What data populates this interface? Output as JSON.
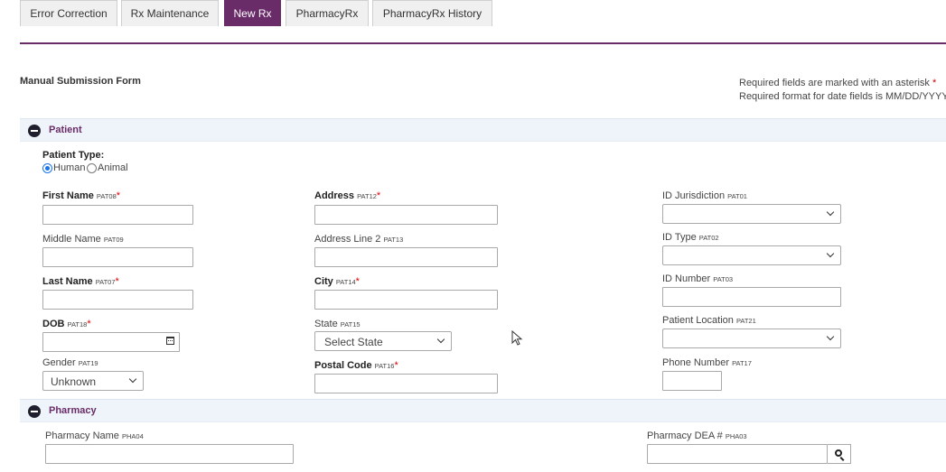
{
  "tabs": [
    {
      "label": "Error Correction",
      "active": false
    },
    {
      "label": "Rx Maintenance",
      "active": false
    },
    {
      "label": "New Rx",
      "active": true
    },
    {
      "label": "PharmacyRx",
      "active": false
    },
    {
      "label": "PharmacyRx History",
      "active": false
    }
  ],
  "form": {
    "title": "Manual Submission Form",
    "required_note": "Required fields are marked with an asterisk",
    "asterisk": "*",
    "date_note": "Required format for date fields is MM/DD/YYYY"
  },
  "patient": {
    "section_title": "Patient",
    "patient_type_label": "Patient Type:",
    "type_options": [
      "Human",
      "Animal"
    ],
    "selected_type": "Human",
    "first_name": {
      "label": "First Name",
      "code": "PAT08",
      "value": ""
    },
    "middle_name": {
      "label": "Middle Name",
      "code": "PAT09",
      "value": ""
    },
    "last_name": {
      "label": "Last Name",
      "code": "PAT07",
      "value": ""
    },
    "dob": {
      "label": "DOB",
      "code": "PAT18",
      "value": ""
    },
    "gender": {
      "label": "Gender",
      "code": "PAT19",
      "value": "Unknown"
    },
    "address": {
      "label": "Address",
      "code": "PAT12",
      "value": ""
    },
    "address2": {
      "label": "Address Line 2",
      "code": "PAT13",
      "value": ""
    },
    "city": {
      "label": "City",
      "code": "PAT14",
      "value": ""
    },
    "state": {
      "label": "State",
      "code": "PAT15",
      "value": "Select State"
    },
    "postal_code": {
      "label": "Postal Code",
      "code": "PAT16",
      "value": ""
    },
    "id_jurisdiction": {
      "label": "ID Jurisdiction",
      "code": "PAT01",
      "value": ""
    },
    "id_type": {
      "label": "ID Type",
      "code": "PAT02",
      "value": ""
    },
    "id_number": {
      "label": "ID Number",
      "code": "PAT03",
      "value": ""
    },
    "patient_location": {
      "label": "Patient Location",
      "code": "PAT21",
      "value": ""
    },
    "phone_number": {
      "label": "Phone Number",
      "code": "PAT17",
      "value": ""
    }
  },
  "pharmacy": {
    "section_title": "Pharmacy",
    "pharmacy_name": {
      "label": "Pharmacy Name",
      "code": "PHA04",
      "value": ""
    },
    "pharmacy_dea": {
      "label": "Pharmacy DEA #",
      "code": "PHA03",
      "value": ""
    }
  },
  "icons": {
    "collapse": "minus-circle-icon",
    "calendar": "calendar-icon",
    "search": "search-icon",
    "dropdown": "chevron-down-icon"
  },
  "colors": {
    "accent": "#6a2c68",
    "section_bg": "#eef4fa",
    "required": "#d00000"
  }
}
